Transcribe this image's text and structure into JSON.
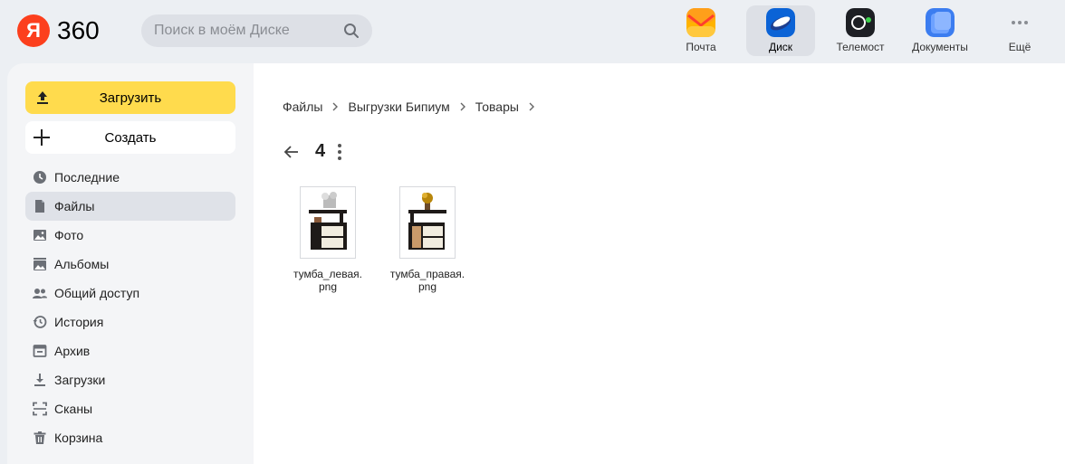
{
  "header": {
    "logo_ya": "Я",
    "logo_360": "360",
    "search_placeholder": "Поиск в моём Диске",
    "apps": [
      {
        "label": "Почта",
        "icon": "mail-icon",
        "color": "#ffb300"
      },
      {
        "label": "Диск",
        "icon": "disk-icon",
        "color": "#0b63d6",
        "active": true
      },
      {
        "label": "Телемост",
        "icon": "telemost-icon",
        "color": "#1d1f24"
      },
      {
        "label": "Документы",
        "icon": "documents-icon",
        "color": "#3c7df0"
      },
      {
        "label": "Ещё",
        "icon": "more-apps-icon"
      }
    ]
  },
  "sidebar": {
    "upload_label": "Загрузить",
    "create_label": "Создать",
    "items": [
      {
        "label": "Последние",
        "icon": "clock-icon"
      },
      {
        "label": "Файлы",
        "icon": "file-icon",
        "active": true
      },
      {
        "label": "Фото",
        "icon": "photo-icon"
      },
      {
        "label": "Альбомы",
        "icon": "albums-icon"
      },
      {
        "label": "Общий доступ",
        "icon": "shared-icon"
      },
      {
        "label": "История",
        "icon": "history-icon"
      },
      {
        "label": "Архив",
        "icon": "archive-icon"
      },
      {
        "label": "Загрузки",
        "icon": "downloads-icon"
      },
      {
        "label": "Сканы",
        "icon": "scans-icon"
      },
      {
        "label": "Корзина",
        "icon": "trash-icon"
      }
    ]
  },
  "main": {
    "breadcrumb": [
      "Файлы",
      "Выгрузки Бипиум",
      "Товары"
    ],
    "folder_title": "4",
    "files": [
      {
        "name": "тумба_левая.png",
        "line1": "тумба_левая.",
        "line2": "png"
      },
      {
        "name": "тумба_правая.png",
        "line1": "тумба_правая.",
        "line2": "png"
      }
    ]
  },
  "colors": {
    "accent_yellow": "#ffdb4d",
    "logo_red": "#fc3f1d",
    "sidebar_bg": "#f4f5f7",
    "header_bg": "#eceff3"
  }
}
